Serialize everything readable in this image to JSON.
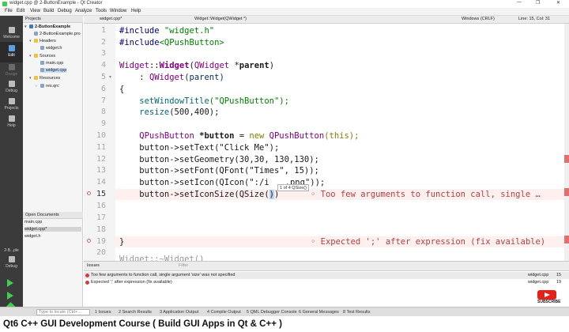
{
  "window": {
    "title": "widget.cpp @ 2-ButtonExample - Qt Creator",
    "controls": [
      "—",
      "❐",
      "✕"
    ]
  },
  "menus": [
    "File",
    "Edit",
    "View",
    "Build",
    "Debug",
    "Analyze",
    "Tools",
    "Window",
    "Help"
  ],
  "modes": [
    {
      "label": "Welcome",
      "icon": "grid-icon"
    },
    {
      "label": "Edit",
      "icon": "edit-icon"
    },
    {
      "label": "Design",
      "icon": "design-icon"
    },
    {
      "label": "Debug",
      "icon": "bug-icon"
    },
    {
      "label": "Projects",
      "icon": "wrench-icon"
    },
    {
      "label": "Help",
      "icon": "help-icon"
    }
  ],
  "kit": {
    "project": "2-B...ple",
    "mode": "Debug"
  },
  "projects": {
    "header": "Projects",
    "tree": [
      {
        "label": "2-ButtonExample"
      },
      {
        "label": "2-ButtonExample.pro"
      },
      {
        "label": "Headers"
      },
      {
        "label": "widget.h"
      },
      {
        "label": "Sources"
      },
      {
        "label": "main.cpp"
      },
      {
        "label": "widget.cpp"
      },
      {
        "label": "Resources"
      },
      {
        "label": "res.qrc"
      }
    ]
  },
  "open_documents": {
    "header": "Open Documents",
    "items": [
      "main.cpp",
      "widget.cpp*",
      "widget.h"
    ]
  },
  "editor_toolbar": {
    "file": "widget.cpp*",
    "symbol": "Widget::Widget(QWidget *)",
    "encoding": "Windows (CRLF)",
    "position": "Line: 15, Col: 31"
  },
  "code": {
    "line_numbers": [
      "1",
      "2",
      "3",
      "4",
      "5",
      "6",
      "7",
      "8",
      "9",
      "10",
      "11",
      "12",
      "13",
      "14",
      "15",
      "16",
      "17",
      "18",
      "19",
      "20"
    ],
    "lines": {
      "l1_directive": "#include",
      "l1_file": " \"widget.h\"",
      "l2_directive": "#include",
      "l2_file": "<QPushButton>",
      "l4_class": "Widget",
      "l4_scope": "::",
      "l4_func": "Widget",
      "l4_open": "(",
      "l4_type": "QWidget",
      "l4_ptr": " *",
      "l4_param": "parent",
      "l4_close": ")",
      "l5_colon": "    : ",
      "l5_base": "QWidget",
      "l5_arg": "(parent)",
      "l6": "{",
      "l7_fn": "    setWindowTitle",
      "l7_arg": "(\"QPushButton\");",
      "l8_fn": "    resize",
      "l8_arg": "(500,400);",
      "l10_type": "    QPushButton",
      "l10_var": " *button",
      "l10_eq": " = ",
      "l10_new": "new",
      "l10_ctor": " QPushButton",
      "l10_this": "(this);",
      "l11": "    button->setText(\"Click Me\");",
      "l12": "    button->setGeometry(30,30, 130,130);",
      "l13": "    button->setFont(QFont(\"Times\", 15));",
      "l14": "    button->setIcon(QIcon(\":/i",
      "l14_rest": ".png\"));",
      "l15": "    button->setIconSize(QSize(",
      "l15_sel": ")",
      "l15_end": ")",
      "l19": "}",
      "l20": "Widget::~Widget()"
    },
    "tooltip": "1 of 4  QSize()",
    "errors": [
      "◦ Too few arguments to function call, single …",
      "◦ Expected ';' after expression (fix available)"
    ]
  },
  "issues": {
    "tab": "Issues",
    "filter_placeholder": "Filter",
    "rows": [
      {
        "message": "Too few arguments to function call, single argument 'size' was not specified",
        "file": "widget.cpp",
        "line": "15"
      },
      {
        "message": "Expected ';' after expression (fix available)",
        "file": "widget.cpp",
        "line": "19"
      }
    ]
  },
  "statusbar": {
    "search_placeholder": "Type to locate (Ctrl+...",
    "tabs": [
      "1 Issues",
      "2 Search Results",
      "3 Application Output",
      "4 Compile Output",
      "5 QML Debugger Console",
      "6 General Messages",
      "8 Test Results"
    ]
  },
  "watermark": {
    "subscribe": "SUBSCRIBE"
  },
  "caption": "Qt6 C++ GUI Development Course ( Build GUI Apps in Qt & C++ )",
  "colors": {
    "modebar": "#3b3b3b",
    "error": "#d43d3d",
    "keyword": "#808000",
    "string": "#008000",
    "type": "#800080"
  }
}
